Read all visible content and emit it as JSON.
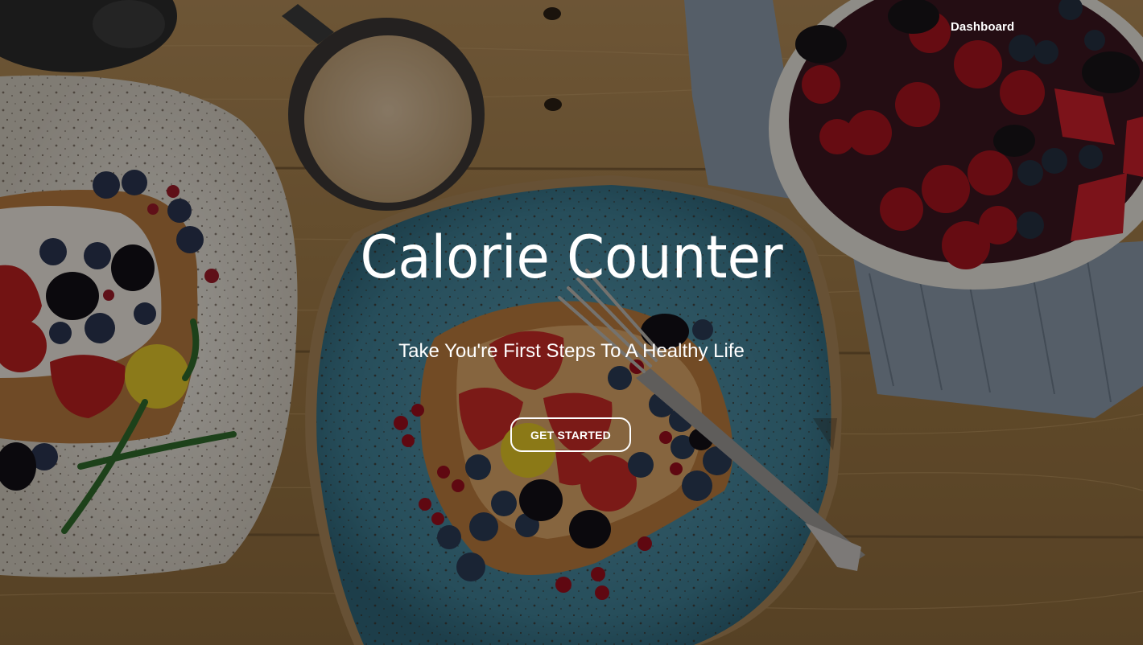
{
  "nav": {
    "dashboard_label": "Dashboard"
  },
  "hero": {
    "title": "Calorie Counter",
    "subtitle": "Take You're First Steps To A Healthy Life",
    "cta_label": "GET STARTED",
    "background_image": "breakfast-table-photo"
  },
  "colors": {
    "text": "#ffffff",
    "wood": "#a8834f",
    "plate_blue": "#4f8ca0",
    "plate_white": "#e8e4dc"
  }
}
